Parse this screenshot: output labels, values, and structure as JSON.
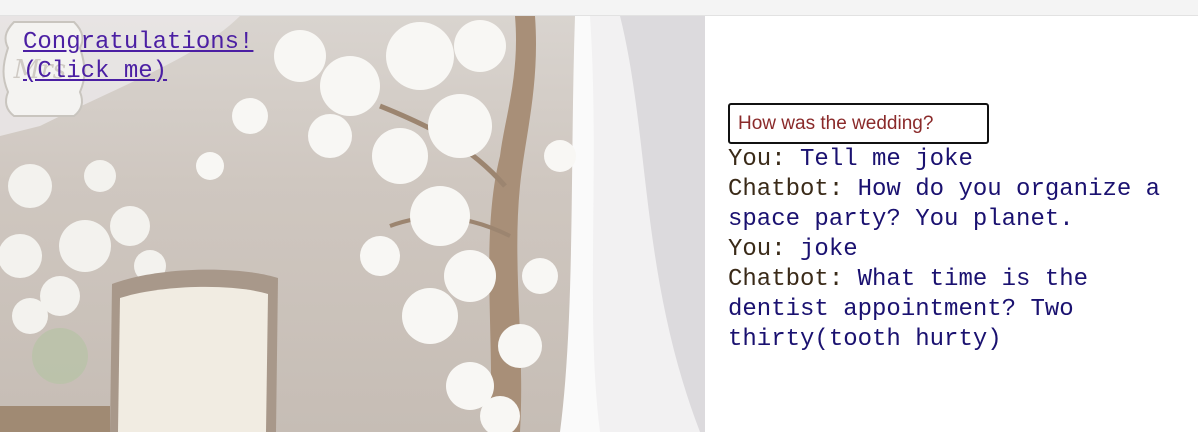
{
  "hero": {
    "link_text": "Congratulations!\n(Click me)",
    "plaque_text": "Mrs."
  },
  "chat": {
    "input_value": "How was the wedding?",
    "messages": [
      {
        "speaker": "You:",
        "text": "Tell me joke"
      },
      {
        "speaker": "Chatbot:",
        "text": "How do you organize a space party? You planet."
      },
      {
        "speaker": "You:",
        "text": "joke"
      },
      {
        "speaker": "Chatbot:",
        "text": "What time is the dentist appointment? Two thirty(tooth hurty)"
      }
    ]
  },
  "colors": {
    "link": "#4b1fa3",
    "speaker": "#3a2a18",
    "message": "#1a1170",
    "input_text": "#8a2a2a"
  }
}
